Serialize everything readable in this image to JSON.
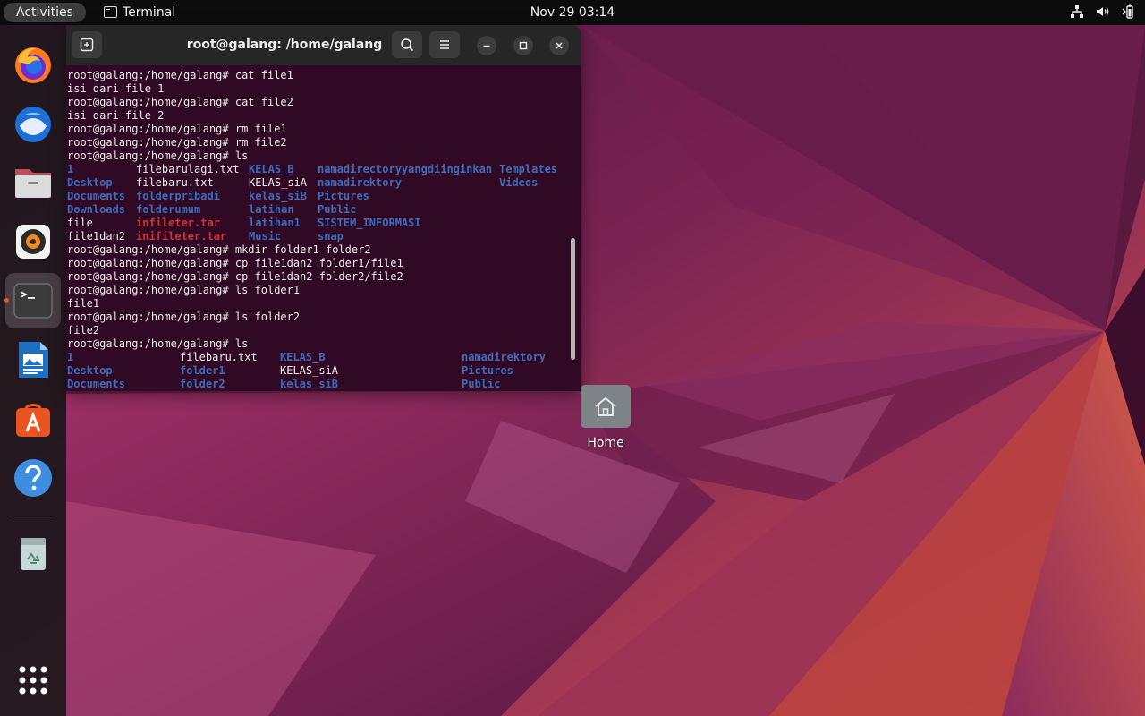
{
  "topbar": {
    "activities": "Activities",
    "app_name": "Terminal",
    "clock": "Nov 29  03:14",
    "tray_icons": [
      "network-icon",
      "volume-icon",
      "battery-icon"
    ]
  },
  "dock": {
    "apps": [
      "firefox",
      "thunderbird",
      "files",
      "rhythmbox",
      "terminal",
      "writer",
      "app-center",
      "help",
      "trash",
      "show-apps"
    ],
    "accent": "#e95420"
  },
  "terminal": {
    "title": "root@galang: /home/galang",
    "lines_before": [
      "root@galang:/home/galang# cat file1",
      "isi dari file 1",
      "root@galang:/home/galang# cat file2",
      "isi dari file 2",
      "root@galang:/home/galang# rm file1",
      "root@galang:/home/galang# rm file2",
      "root@galang:/home/galang# ls"
    ],
    "ls1": [
      [
        "1",
        "dir"
      ],
      [
        "filebarulagi.txt",
        "file"
      ],
      [
        "KELAS_B",
        "dir"
      ],
      [
        "namadirectoryyangdiinginkan",
        "dir"
      ],
      [
        "Templates",
        "dir"
      ],
      [
        "Desktop",
        "dir"
      ],
      [
        "filebaru.txt",
        "file"
      ],
      [
        "KELAS_siA",
        "file"
      ],
      [
        "namadirektory",
        "dir"
      ],
      [
        "Videos",
        "dir"
      ],
      [
        "Documents",
        "dir"
      ],
      [
        "folderpribadi",
        "dir"
      ],
      [
        "kelas_siB",
        "dir"
      ],
      [
        "Pictures",
        "dir"
      ],
      [
        "",
        "file"
      ],
      [
        "Downloads",
        "dir"
      ],
      [
        "folderumum",
        "dir"
      ],
      [
        "latihan",
        "dir"
      ],
      [
        "Public",
        "dir"
      ],
      [
        "",
        "file"
      ],
      [
        "file",
        "file"
      ],
      [
        "infileter.tar",
        "arch"
      ],
      [
        "latihan1",
        "dir"
      ],
      [
        "SISTEM_INFORMASI",
        "dir"
      ],
      [
        "",
        "file"
      ],
      [
        "file1dan2",
        "file"
      ],
      [
        "inifileter.tar",
        "arch"
      ],
      [
        "Music",
        "dir"
      ],
      [
        "snap",
        "dir"
      ],
      [
        "",
        "file"
      ]
    ],
    "lines_middle": [
      "root@galang:/home/galang# mkdir folder1 folder2",
      "root@galang:/home/galang# cp file1dan2 folder1/file1",
      "root@galang:/home/galang# cp file1dan2 folder2/file2",
      "root@galang:/home/galang# ls folder1",
      "file1",
      "root@galang:/home/galang# ls folder2",
      "file2",
      "root@galang:/home/galang# ls"
    ],
    "ls2": [
      [
        "1",
        "dir"
      ],
      [
        "filebaru.txt",
        "file"
      ],
      [
        "KELAS_B",
        "dir"
      ],
      [
        "namadirektory",
        "dir"
      ],
      [
        "Desktop",
        "dir"
      ],
      [
        "folder1",
        "dir"
      ],
      [
        "KELAS_siA",
        "file"
      ],
      [
        "Pictures",
        "dir"
      ],
      [
        "Documents",
        "dir"
      ],
      [
        "folder2",
        "dir"
      ],
      [
        "kelas_siB",
        "dir"
      ],
      [
        "Public",
        "dir"
      ]
    ],
    "colors": {
      "dir": "#3e6bb9",
      "file": "#ececec",
      "arch": "#d0323a",
      "background": "#300a24"
    }
  },
  "desktop": {
    "home_label": "Home"
  }
}
